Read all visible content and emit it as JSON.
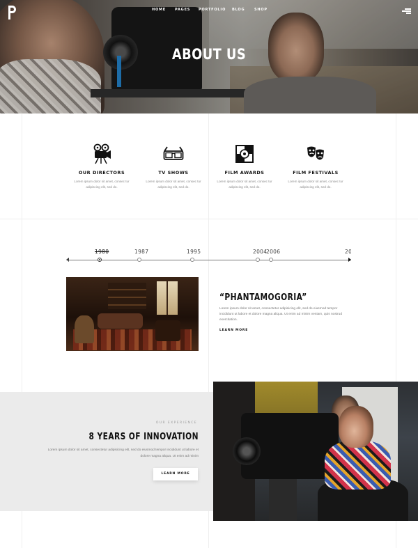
{
  "header": {
    "logo_letter": "P",
    "nav": [
      "HOME",
      "PAGES",
      "PORTFOLIO",
      "BLOG",
      "SHOP"
    ],
    "menu_icon": "hamburger-icon"
  },
  "hero": {
    "title": "ABOUT US"
  },
  "features": [
    {
      "icon": "film-projector-icon",
      "title": "OUR DIRECTORS",
      "text": "Lorem ipsum dolor sit amet, consec tur adipiscing elit, sed do."
    },
    {
      "icon": "3d-glasses-icon",
      "title": "TV SHOWS",
      "text": "Lorem ipsum dolor sit amet, consec tur adipiscing elit, sed do."
    },
    {
      "icon": "film-award-icon",
      "title": "FILM AWARDS",
      "text": "Lorem ipsum dolor sit amet, consec tur adipiscing elit, sed do."
    },
    {
      "icon": "theater-masks-icon",
      "title": "FILM FESTIVALS",
      "text": "Lorem ipsum dolor sit amet, consec tur adipiscing elit, sed do."
    }
  ],
  "timeline": {
    "years": [
      "1980",
      "1987",
      "1995",
      "2004",
      "2006",
      "20"
    ],
    "active": "1980"
  },
  "story": {
    "title": "“PHANTAMOGORIA”",
    "text": "Lorem ipsum dolor sit amet, consectetur adipisicing elit, sed do eiusmod tempor incididunt ut labore et dolore magna aliqua. Ut enim ad minim veniam, quis nostrud exercitation.",
    "link": "LEARN MORE"
  },
  "experience": {
    "eyebrow": "OUR EXPERIENCE",
    "title": "8 YEARS OF INNOVATION",
    "text": "Lorem ipsum dolor sit amet, consectetur adipisicing elit, sed do eiusmod tempor incididunt ut labore et dolore magna aliqua. Ut enim ad minim",
    "button": "LEARN MORE"
  }
}
